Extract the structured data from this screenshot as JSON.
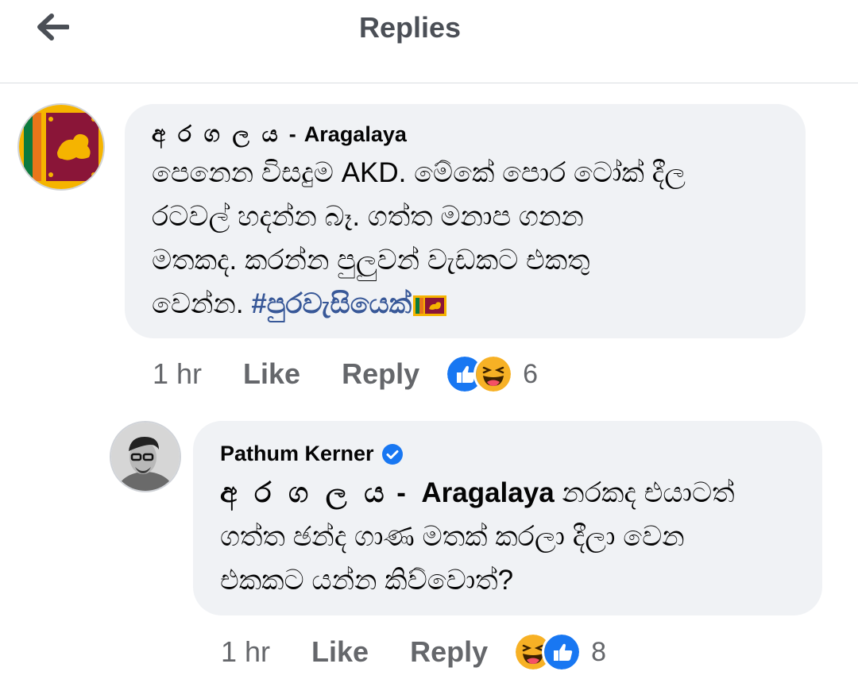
{
  "header": {
    "title": "Replies",
    "back_icon": "arrow-left-icon"
  },
  "comments": [
    {
      "author_sinhala": "අ ර ග ල ය",
      "author_sep": "-",
      "author_latin": "Aragalaya",
      "lines": [
        "පෙනෙන විසදුම AKD. මේකේ පොර ටෝක් දීල",
        "රටවල් හදන්න බෑ. ගත්ත මනාප ගනන",
        "මතකද. කරන්න පුලුවන් වැඩකට එකතු"
      ],
      "last_line_text": "වෙන්න.",
      "hashtag": "#පුරවැසියෙක්",
      "time": "1 hr",
      "like_label": "Like",
      "reply_label": "Reply",
      "reaction_count": "6",
      "reactions": [
        "like",
        "haha"
      ]
    },
    {
      "author": "Pathum Kerner",
      "verified": true,
      "mention_sinhala": "අ ර ග ල ය",
      "mention_sep": "-",
      "mention_latin": "Aragalaya",
      "first_line_rest": "නරකද එයාටත්",
      "lines": [
        "ගත්ත ඡන්ද ගාණ මතක් කරලා දීලා වෙන",
        "එකකට යන්න කිව්වොත්?"
      ],
      "time": "1 hr",
      "like_label": "Like",
      "reply_label": "Reply",
      "reaction_count": "8",
      "reactions": [
        "haha",
        "like"
      ]
    }
  ],
  "colors": {
    "bubble": "#f0f2f5",
    "hashtag": "#385898",
    "meta": "#65676b",
    "like_blue": "#1877f2",
    "verified": "#1877f2",
    "haha_yellow": "#f7b125"
  }
}
